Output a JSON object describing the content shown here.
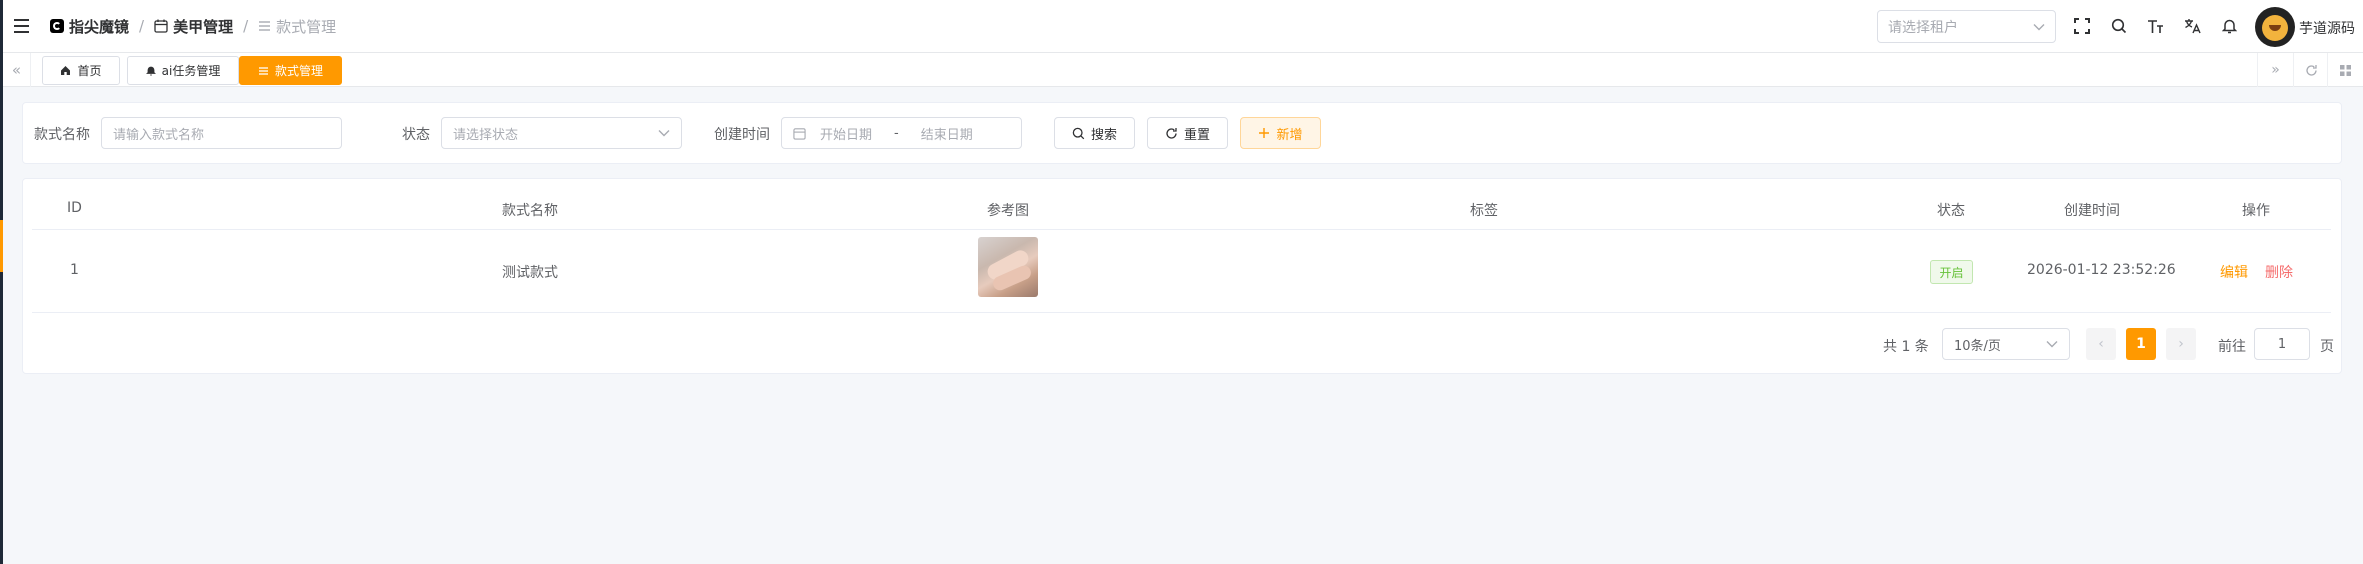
{
  "header": {
    "brand": "指尖魔镜",
    "breadcrumb_parent": "美甲管理",
    "breadcrumb_current": "款式管理",
    "tenant_placeholder": "请选择租户",
    "username": "芋道源码",
    "icons": [
      "menu-icon",
      "calendar-icon",
      "list-icon",
      "fullscreen-icon",
      "search-icon",
      "font-size-icon",
      "translate-icon",
      "bell-icon"
    ]
  },
  "tags": [
    {
      "label": "首页",
      "icon": "home-icon",
      "active": false
    },
    {
      "label": "ai任务管理",
      "icon": "bell-icon",
      "active": false
    },
    {
      "label": "款式管理",
      "icon": "list-icon",
      "active": true
    }
  ],
  "search": {
    "name_label": "款式名称",
    "name_placeholder": "请输入款式名称",
    "status_label": "状态",
    "status_placeholder": "请选择状态",
    "created_label": "创建时间",
    "start_placeholder": "开始日期",
    "range_separator": "-",
    "end_placeholder": "结束日期",
    "search_button": "搜索",
    "reset_button": "重置",
    "add_button": "新增"
  },
  "table": {
    "columns": [
      "ID",
      "款式名称",
      "参考图",
      "标签",
      "状态",
      "创建时间",
      "操作"
    ],
    "rows": [
      {
        "id": "1",
        "name": "测试款式",
        "tags": "",
        "status": "开启",
        "created": "2026-01-12 23:52:26",
        "edit": "编辑",
        "delete": "删除"
      }
    ]
  },
  "pagination": {
    "total_text": "共 1 条",
    "page_size": "10条/页",
    "prev": "‹",
    "current_page": "1",
    "next": "›",
    "goto_label": "前往",
    "goto_value": "1",
    "goto_suffix": "页"
  },
  "colors": {
    "primary": "#ff9900",
    "danger": "#f56c6c",
    "success": "#67c23a"
  }
}
